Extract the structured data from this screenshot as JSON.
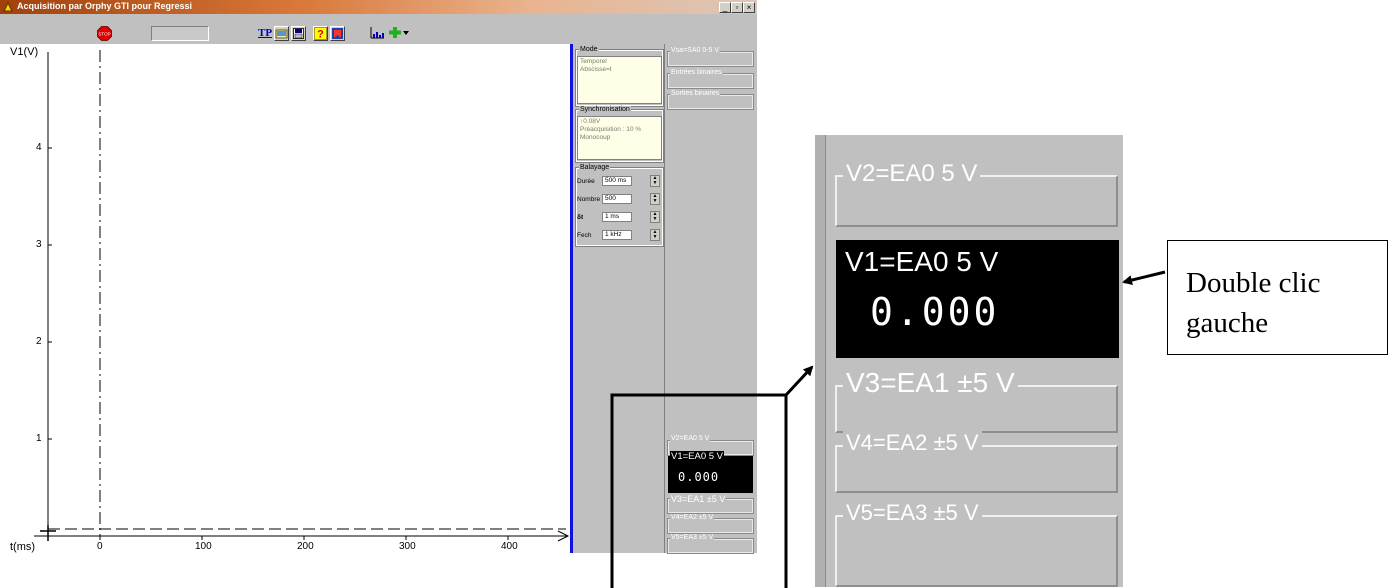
{
  "window": {
    "title": "Acquisition par Orphy GTI pour Regressi",
    "minimize_label": "_",
    "maximize_label": "▫",
    "close_label": "×"
  },
  "toolbar": {
    "stop_label": "STOP",
    "tp_label": "TP",
    "icons": [
      "stop-icon",
      "tp-icon",
      "open-folder-icon",
      "save-disk-icon",
      "help-icon",
      "bookmark-icon",
      "chart-bars-icon",
      "add-dropdown-icon"
    ]
  },
  "plot": {
    "y_label": "V1(V)",
    "x_label": "t(ms)",
    "y_ticks": [
      "4",
      "3",
      "2",
      "1"
    ],
    "x_ticks": [
      "0",
      "100",
      "200",
      "300",
      "400"
    ]
  },
  "mode": {
    "legend": "Mode",
    "line1": "Temporel",
    "line2": "Abscisse=t"
  },
  "synchronisation": {
    "legend": "Synchronisation",
    "line1": "↑0.08V",
    "line2": "Préacquisition : 10 %",
    "line3": "Monocoup"
  },
  "balayage": {
    "legend": "Balayage",
    "rows": [
      {
        "label": "Durée",
        "value": "500 ms"
      },
      {
        "label": "Nombre",
        "value": "500"
      },
      {
        "label": "δt",
        "value": "1 ms"
      },
      {
        "label": "Fech",
        "value": "1 kHz"
      }
    ]
  },
  "channels_top": {
    "vsa": "Vsa=SA0 0-5 V",
    "entrees": "Entrées binaires",
    "sorties": "Sorties binaires"
  },
  "channels": {
    "v2": "V2=EA0 5 V",
    "v1": "V1=EA0 5 V",
    "v1_value": "0.000",
    "v3": "V3=EA1 ±5 V",
    "v4": "V4=EA2 ±5 V",
    "v5": "V5=EA3 ±5 V"
  },
  "callout": {
    "line1": "Double clic",
    "line2": "gauche"
  },
  "colors": {
    "panel_bg": "#c0c0c0",
    "accent_blue": "#1010e0",
    "active_channel_bg": "#000000"
  }
}
